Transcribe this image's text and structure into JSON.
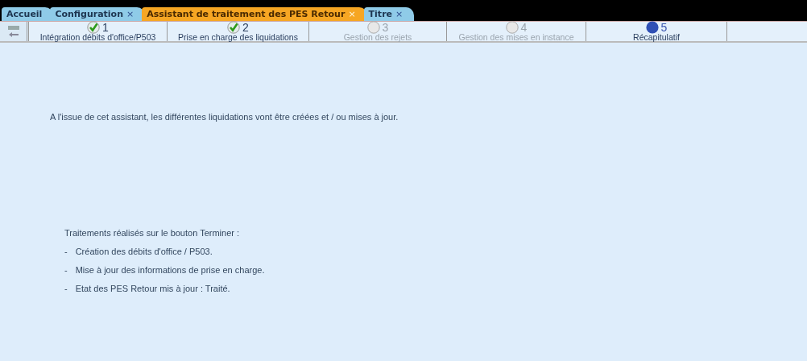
{
  "tabs": [
    {
      "label": "Accueil",
      "closable": false,
      "selected": false
    },
    {
      "label": "Configuration",
      "closable": true,
      "selected": false
    },
    {
      "label": "Assistant de traitement des PES Retour",
      "closable": true,
      "selected": true
    },
    {
      "label": "Titre",
      "closable": true,
      "selected": false
    }
  ],
  "close_glyph": "×",
  "steps": [
    {
      "number": "1",
      "label": "Intégration débits d'office/P503",
      "kind": "done"
    },
    {
      "number": "2",
      "label": "Prise en charge des liquidations",
      "kind": "done"
    },
    {
      "number": "3",
      "label": "Gestion des rejets",
      "kind": "pending"
    },
    {
      "number": "4",
      "label": "Gestion des mises en instance",
      "kind": "pending"
    },
    {
      "number": "5",
      "label": "Récapitulatif",
      "kind": "current"
    }
  ],
  "intro": "A l'issue de cet assistant, les différentes liquidations vont être créées et / ou mises à jour.",
  "actions_title": "Traitements réalisés sur le bouton Terminer :",
  "actions": [
    {
      "bullet": "-",
      "text": "Création des débits d'office / P503."
    },
    {
      "bullet": "-",
      "text": "Mise à jour des informations de prise en charge."
    },
    {
      "bullet": "-",
      "text": "Etat des PES Retour mis à jour : Traité."
    }
  ]
}
